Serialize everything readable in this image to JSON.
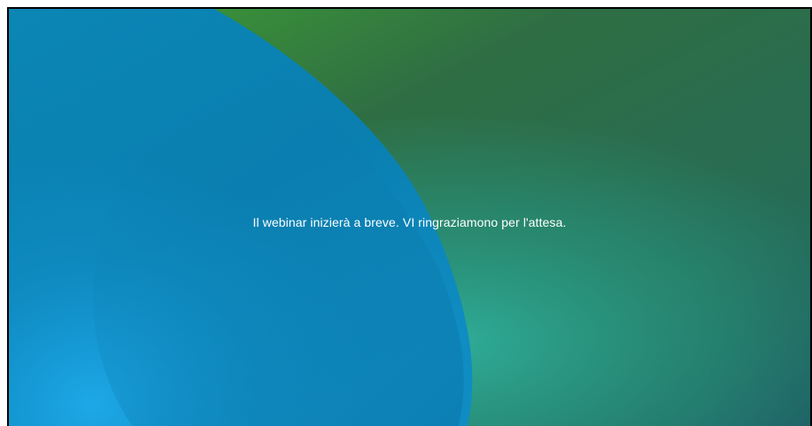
{
  "waiting_screen": {
    "message": "Il webinar inizierà a breve. VI ringraziamono per l'attesa."
  },
  "colors": {
    "blue_deep": "#0a7db1",
    "blue_bright": "#1aa5e3",
    "green_bright": "#3da02f",
    "green_dark": "#2a6a45",
    "teal": "#2a9d88",
    "teal_dark": "#1f5f5e",
    "text": "#ffffff"
  }
}
